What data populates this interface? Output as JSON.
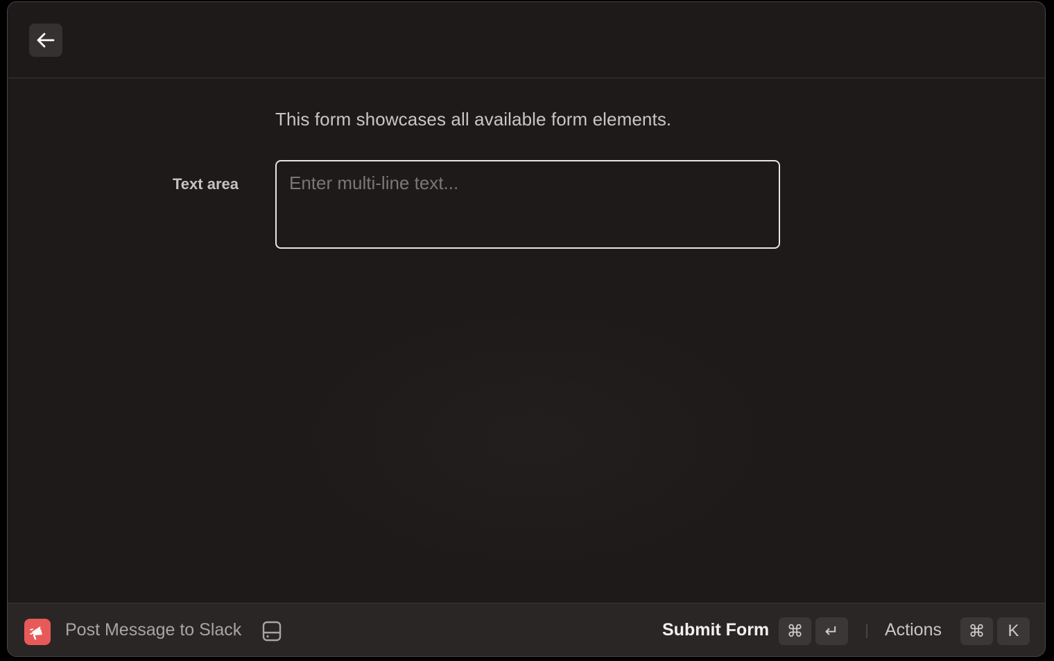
{
  "header": {
    "back_icon": "arrow-left-icon"
  },
  "form": {
    "description": "This form showcases all available form elements.",
    "fields": [
      {
        "label": "Text area",
        "value": "",
        "placeholder": "Enter multi-line text..."
      }
    ]
  },
  "footer": {
    "extension_icon": "slack-megaphone-icon",
    "extension_name": "Post Message to Slack",
    "dev_icon": "drive-icon",
    "primary_action": "Submit Form",
    "primary_shortcut": [
      "⌘",
      "↵"
    ],
    "secondary_action": "Actions",
    "secondary_shortcut": [
      "⌘",
      "K"
    ]
  },
  "colors": {
    "background": "#1d1a19",
    "footer_background": "#2a2625",
    "accent": "#e85a5a",
    "textarea_border": "#e8e6e5"
  }
}
